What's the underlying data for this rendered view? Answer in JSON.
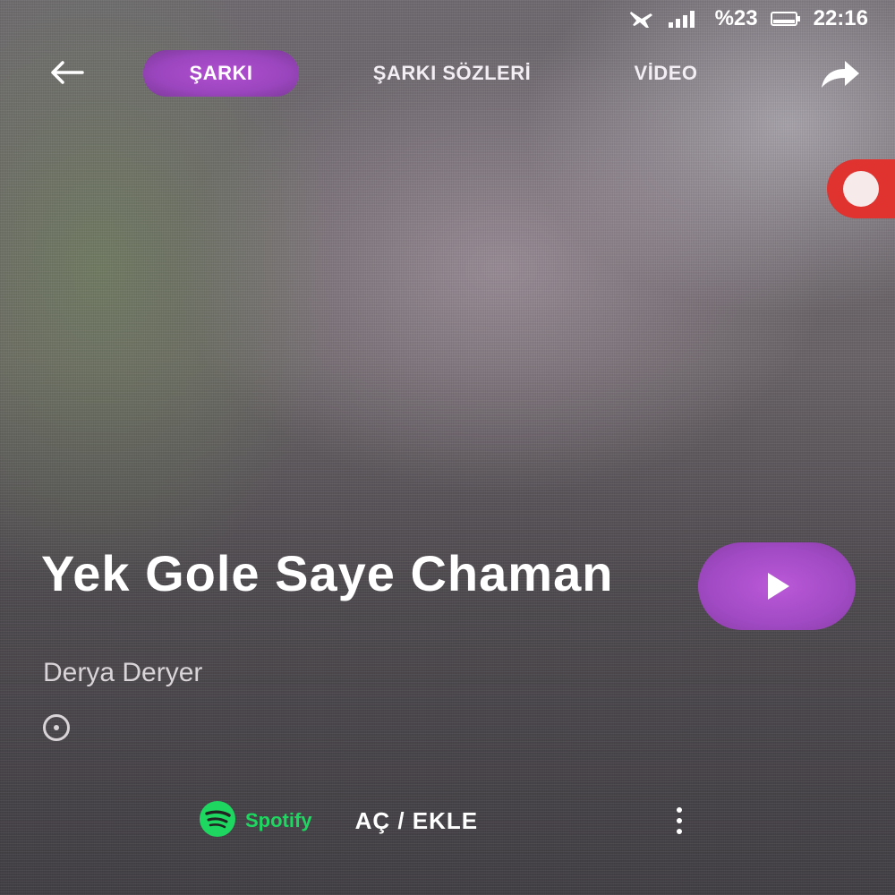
{
  "status_bar": {
    "battery": "%23",
    "time": "22:16"
  },
  "nav": {
    "tabs": [
      {
        "label": "ŞARKI"
      },
      {
        "label": "ŞARKI SÖZLERİ"
      },
      {
        "label": "VİDEO"
      }
    ]
  },
  "song": {
    "title": "Yek Gole Saye Chaman",
    "artist": "Derya Deryer"
  },
  "bottom": {
    "spotify_label": "Spotify",
    "action_label": "AÇ / EKLE"
  },
  "colors": {
    "accent": "#a64bc8",
    "spotify": "#1ed760",
    "record": "#e0322e"
  }
}
